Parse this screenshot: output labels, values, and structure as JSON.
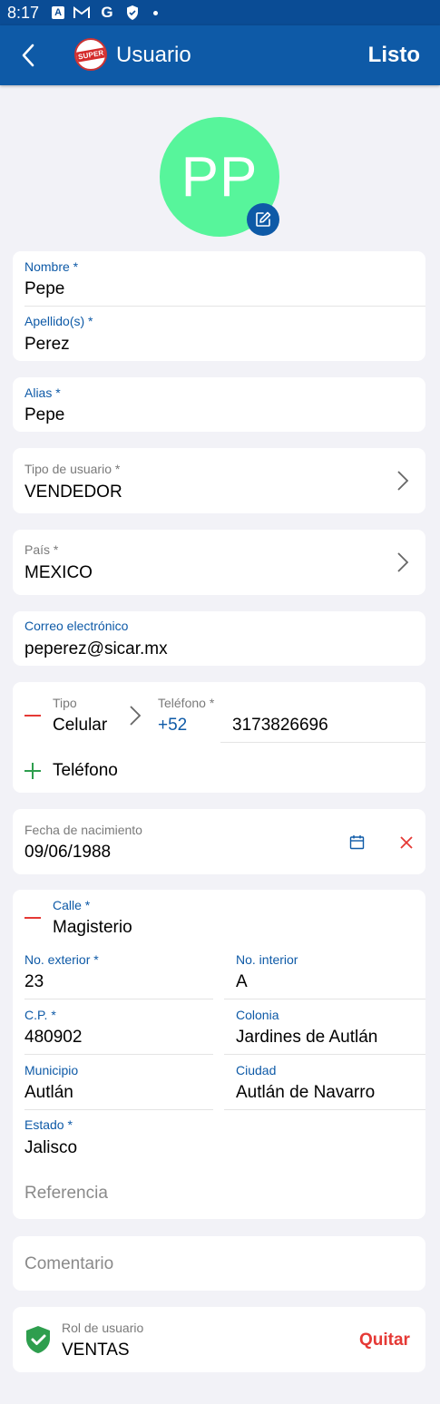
{
  "status_bar": {
    "time": "8:17"
  },
  "app_bar": {
    "title": "Usuario",
    "done_label": "Listo",
    "logo_text": "SUPER"
  },
  "avatar": {
    "initials": "PP"
  },
  "nombre": {
    "label": "Nombre *",
    "value": "Pepe"
  },
  "apellidos": {
    "label": "Apellido(s) *",
    "value": "Perez"
  },
  "alias": {
    "label": "Alias *",
    "value": "Pepe"
  },
  "tipo_usuario": {
    "label": "Tipo de usuario *",
    "value": "VENDEDOR"
  },
  "pais": {
    "label": "País *",
    "value": "MEXICO"
  },
  "correo": {
    "label": "Correo electrónico",
    "value": "peperez@sicar.mx"
  },
  "telefono": {
    "tipo_label": "Tipo",
    "tipo_value": "Celular",
    "telefono_label": "Teléfono *",
    "prefix": "+52",
    "number": "3173826696",
    "add_label": "Teléfono"
  },
  "fecha": {
    "label": "Fecha de nacimiento",
    "value": "09/06/1988"
  },
  "direccion": {
    "calle_label": "Calle *",
    "calle_value": "Magisterio",
    "no_ext_label": "No. exterior *",
    "no_ext_value": "23",
    "no_int_label": "No. interior",
    "no_int_value": "A",
    "cp_label": "C.P. *",
    "cp_value": "480902",
    "colonia_label": "Colonia",
    "colonia_value": "Jardines de Autlán",
    "municipio_label": "Municipio",
    "municipio_value": "Autlán",
    "ciudad_label": "Ciudad",
    "ciudad_value": "Autlán de Navarro",
    "estado_label": "Estado *",
    "estado_value": "Jalisco",
    "referencia_placeholder": "Referencia"
  },
  "comentario": {
    "placeholder": "Comentario"
  },
  "rol": {
    "label": "Rol de usuario",
    "value": "VENTAS",
    "remove_label": "Quitar"
  },
  "colors": {
    "primary": "#0e5aa7",
    "status_bar": "#0a4c95",
    "avatar_bg": "#57f59b",
    "danger": "#e53935",
    "success": "#2e9e4e"
  }
}
